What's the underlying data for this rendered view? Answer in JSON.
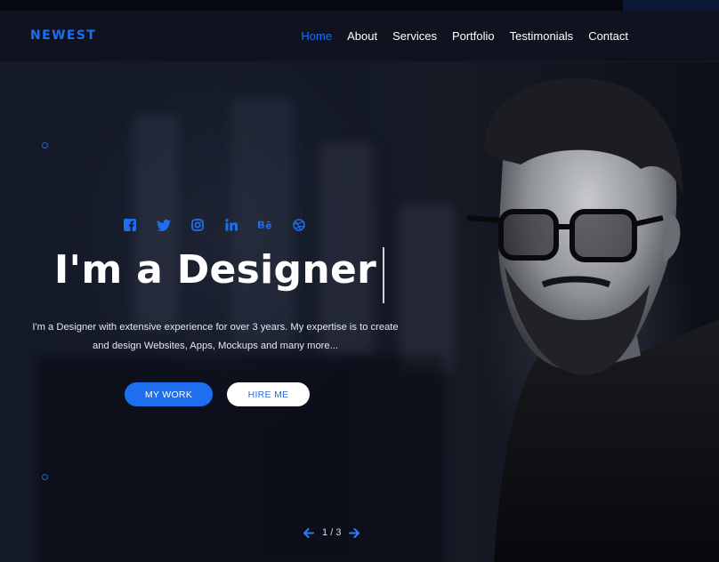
{
  "brand": {
    "logo": "NEWEST",
    "accent": "#1e6ff0"
  },
  "nav": {
    "items": [
      {
        "label": "Home",
        "active": true
      },
      {
        "label": "About"
      },
      {
        "label": "Services"
      },
      {
        "label": "Portfolio"
      },
      {
        "label": "Testimonials"
      },
      {
        "label": "Contact"
      }
    ]
  },
  "hero": {
    "social_icons": [
      "facebook-icon",
      "twitter-icon",
      "instagram-icon",
      "linkedin-icon",
      "behance-icon",
      "dribbble-icon"
    ],
    "headline": "I'm a Designer",
    "description_line1": "I'm a Designer with extensive experience for over 3 years. My expertise is to create",
    "description_line2": "and design Websites, Apps, Mockups and many more...",
    "primary_button": "MY WORK",
    "secondary_button": "HIRE ME"
  },
  "slider": {
    "current": "1",
    "separator": "/",
    "total": "3"
  }
}
